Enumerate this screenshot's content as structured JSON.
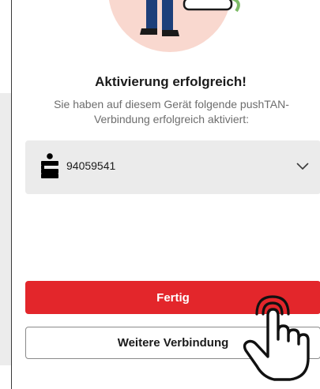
{
  "screen": {
    "title": "Aktivierung erfolgreich!",
    "subtitle": "Sie haben auf diesem Gerät folgende pushTAN-Verbindung erfolgreich aktiviert:"
  },
  "connection_select": {
    "icon": "sparkasse-icon",
    "value": "94059541",
    "expand_icon": "chevron-down-icon"
  },
  "actions": {
    "primary_label": "Fertig",
    "secondary_label": "Weitere Verbindung"
  },
  "overlay": {
    "icon": "tap-hand-icon"
  },
  "colors": {
    "accent_red": "#e3262b",
    "illustration_blush": "#f9d8cf",
    "illustration_navy": "#1d3f7a",
    "illustration_green": "#7dbb67"
  }
}
